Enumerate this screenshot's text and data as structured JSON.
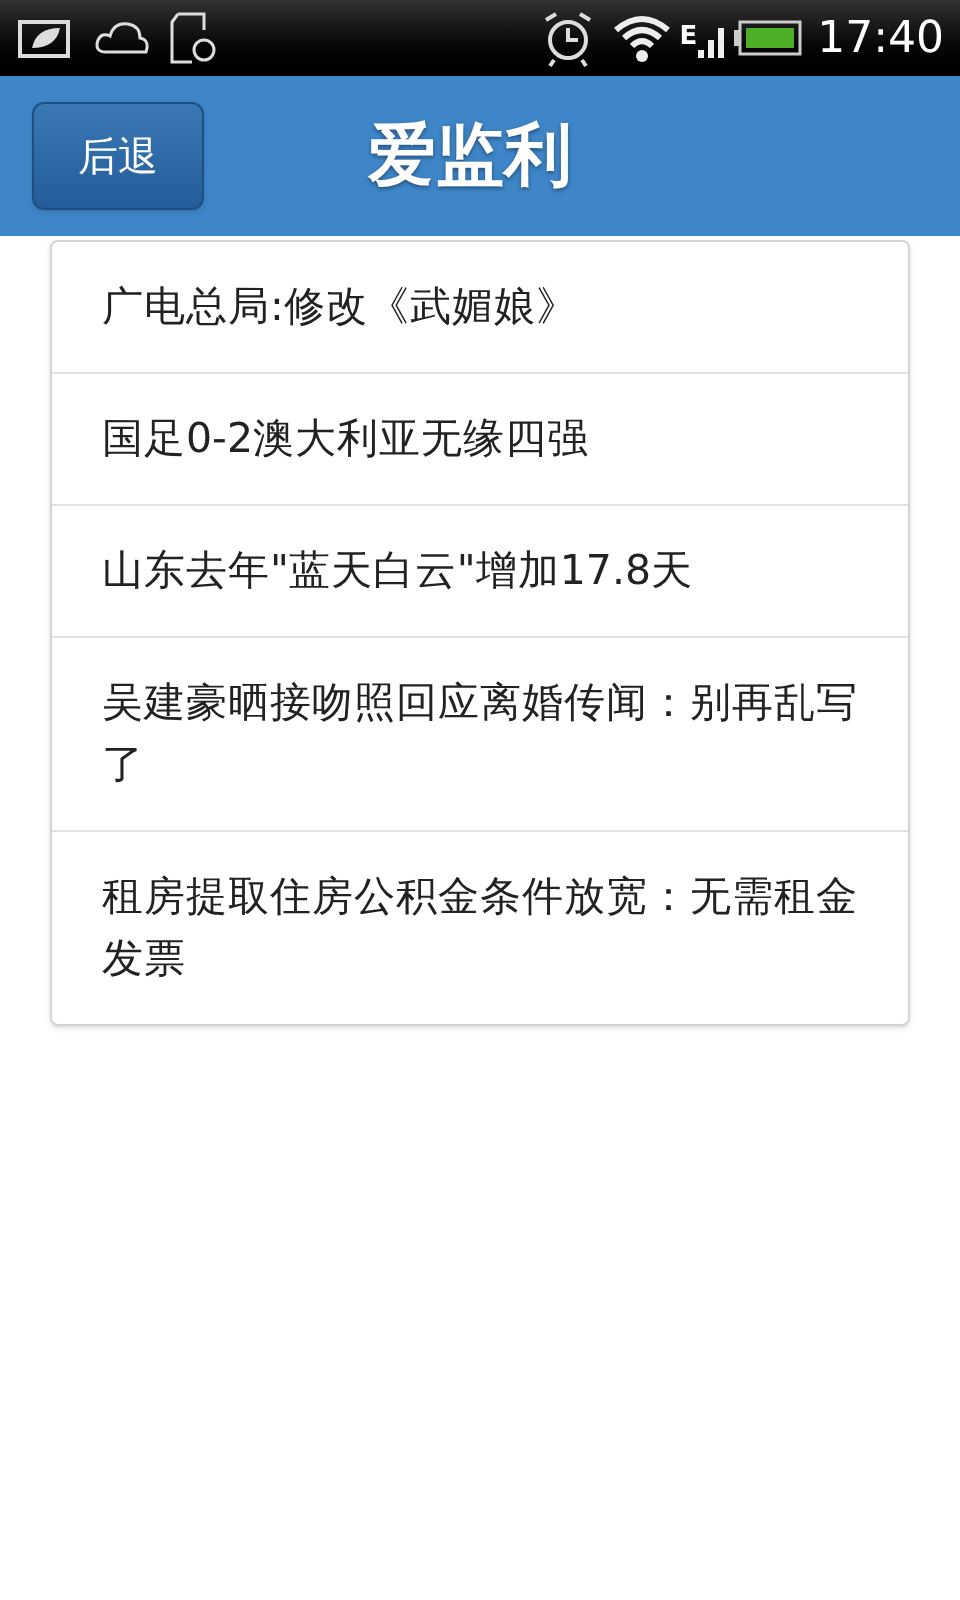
{
  "status_bar": {
    "time": "17:40",
    "network": "E"
  },
  "header": {
    "back_button": "后退",
    "title": "爱监利"
  },
  "news": [
    {
      "title": "广电总局:修改《武媚娘》"
    },
    {
      "title": "国足0-2澳大利亚无缘四强"
    },
    {
      "title": "山东去年\"蓝天白云\"增加17.8天"
    },
    {
      "title": "吴建豪晒接吻照回应离婚传闻：别再乱写了"
    },
    {
      "title": "租房提取住房公积金条件放宽：无需租金发票"
    }
  ]
}
